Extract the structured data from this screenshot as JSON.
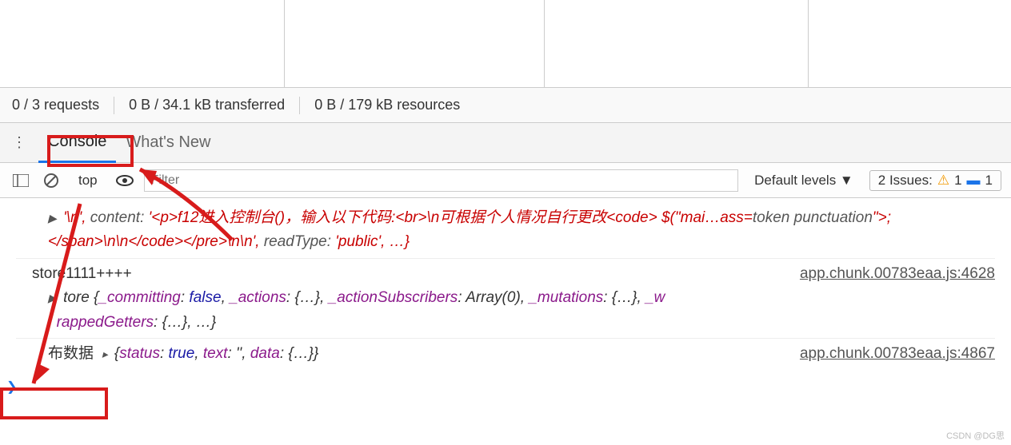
{
  "status": {
    "requests": "0 / 3 requests",
    "transferred": "0 B / 34.1 kB transferred",
    "resources": "0 B / 179 kB resources"
  },
  "tabs": {
    "console": "Console",
    "whatsnew": "What's New"
  },
  "toolbar": {
    "context": "top",
    "filter_placeholder": "Filter",
    "levels": "Default levels ▼",
    "issues_label": "2 Issues:",
    "warn_count": "1",
    "info_count": "1"
  },
  "logs": {
    "line0": "\\n', content: '<p>f12进入控制台()，输入以下代码:<br>\\n可根据个人情况自行更改<code> $(\"mai…ass=token punctuation\">;</span>\\n\\n</code></pre>\\n\\n', readType: 'public', …}",
    "line1_label": "store1111++++",
    "line1_src": "app.chunk.00783eaa.js:4628",
    "line1_body": "tore {_committing: false, _actions: {…}, _actionSubscribers: Array(0), _mutations: {…}, _wrappedGetters: {…}, …}",
    "line2_label": "布数据",
    "line2_body": "▸ {status: true, text: '', data: {…}}",
    "line2_src": "app.chunk.00783eaa.js:4867"
  },
  "watermark": "CSDN @DG思"
}
